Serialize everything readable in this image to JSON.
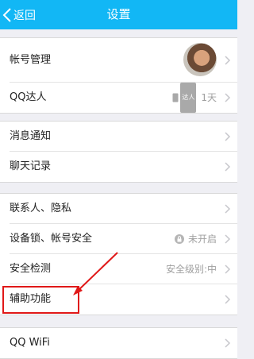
{
  "navbar": {
    "back_label": "返回",
    "title": "设置"
  },
  "group1": {
    "account": {
      "label": "帐号管理"
    },
    "qq_master": {
      "label": "QQ达人",
      "badge": "达人",
      "value": "1天"
    }
  },
  "group2": {
    "notifications": {
      "label": "消息通知"
    },
    "chat_history": {
      "label": "聊天记录"
    }
  },
  "group3": {
    "contacts_privacy": {
      "label": "联系人、隐私"
    },
    "device_lock": {
      "label": "设备锁、帐号安全",
      "value": "未开启"
    },
    "security_check": {
      "label": "安全检测",
      "value": "安全级别:中"
    },
    "accessibility": {
      "label": "辅助功能"
    }
  },
  "group4": {
    "qq_wifi": {
      "label": "QQ WiFi"
    }
  },
  "colors": {
    "accent": "#12b7f5",
    "annotation": "#e01818"
  }
}
